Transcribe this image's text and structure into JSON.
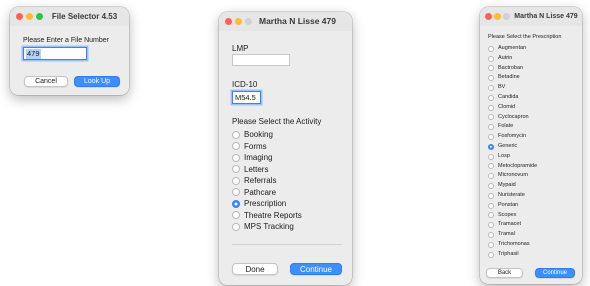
{
  "file_selector": {
    "title": "File Selector 4.53",
    "prompt": "Please Enter a File Number",
    "file_number": "479",
    "cancel_label": "Cancel",
    "lookup_label": "Look Up"
  },
  "activity_window": {
    "title": "Martha N Lisse 479",
    "lmp_label": "LMP",
    "lmp_value": "",
    "icd_label": "ICD-10",
    "icd_value": "M54.5",
    "activity_prompt": "Please Select the Activity",
    "activities": [
      {
        "label": "Booking",
        "selected": false
      },
      {
        "label": "Forms",
        "selected": false
      },
      {
        "label": "Imaging",
        "selected": false
      },
      {
        "label": "Letters",
        "selected": false
      },
      {
        "label": "Referrals",
        "selected": false
      },
      {
        "label": "Pathcare",
        "selected": false
      },
      {
        "label": "Prescription",
        "selected": true
      },
      {
        "label": "Theatre Reports",
        "selected": false
      },
      {
        "label": "MPS Tracking",
        "selected": false
      }
    ],
    "done_label": "Done",
    "continue_label": "Continue"
  },
  "prescription_window": {
    "title": "Martha N Lisse 479",
    "prompt": "Please Select the Prescription",
    "items": [
      {
        "label": "Augmentan",
        "selected": false
      },
      {
        "label": "Autrin",
        "selected": false
      },
      {
        "label": "Bactroban",
        "selected": false
      },
      {
        "label": "Betadine",
        "selected": false
      },
      {
        "label": "BV",
        "selected": false
      },
      {
        "label": "Candida",
        "selected": false
      },
      {
        "label": "Clomid",
        "selected": false
      },
      {
        "label": "Cyclocapron",
        "selected": false
      },
      {
        "label": "Folate",
        "selected": false
      },
      {
        "label": "Fosfomycin",
        "selected": false
      },
      {
        "label": "Generic",
        "selected": true
      },
      {
        "label": "Losp",
        "selected": false
      },
      {
        "label": "Metoclopramide",
        "selected": false
      },
      {
        "label": "Micronovum",
        "selected": false
      },
      {
        "label": "Mypaid",
        "selected": false
      },
      {
        "label": "Nuristerate",
        "selected": false
      },
      {
        "label": "Ponstan",
        "selected": false
      },
      {
        "label": "Scopex",
        "selected": false
      },
      {
        "label": "Tramacet",
        "selected": false
      },
      {
        "label": "Tramal",
        "selected": false
      },
      {
        "label": "Trichomonas",
        "selected": false
      },
      {
        "label": "Triphasil",
        "selected": false
      }
    ],
    "back_label": "Back",
    "continue_label": "Continue"
  },
  "colors": {
    "accent": "#3a82f7",
    "primary_button": "#3d8fff",
    "window_bg": "#ececec",
    "close": "#ff5f57",
    "minimize": "#febc2e",
    "zoom": "#28c840"
  }
}
